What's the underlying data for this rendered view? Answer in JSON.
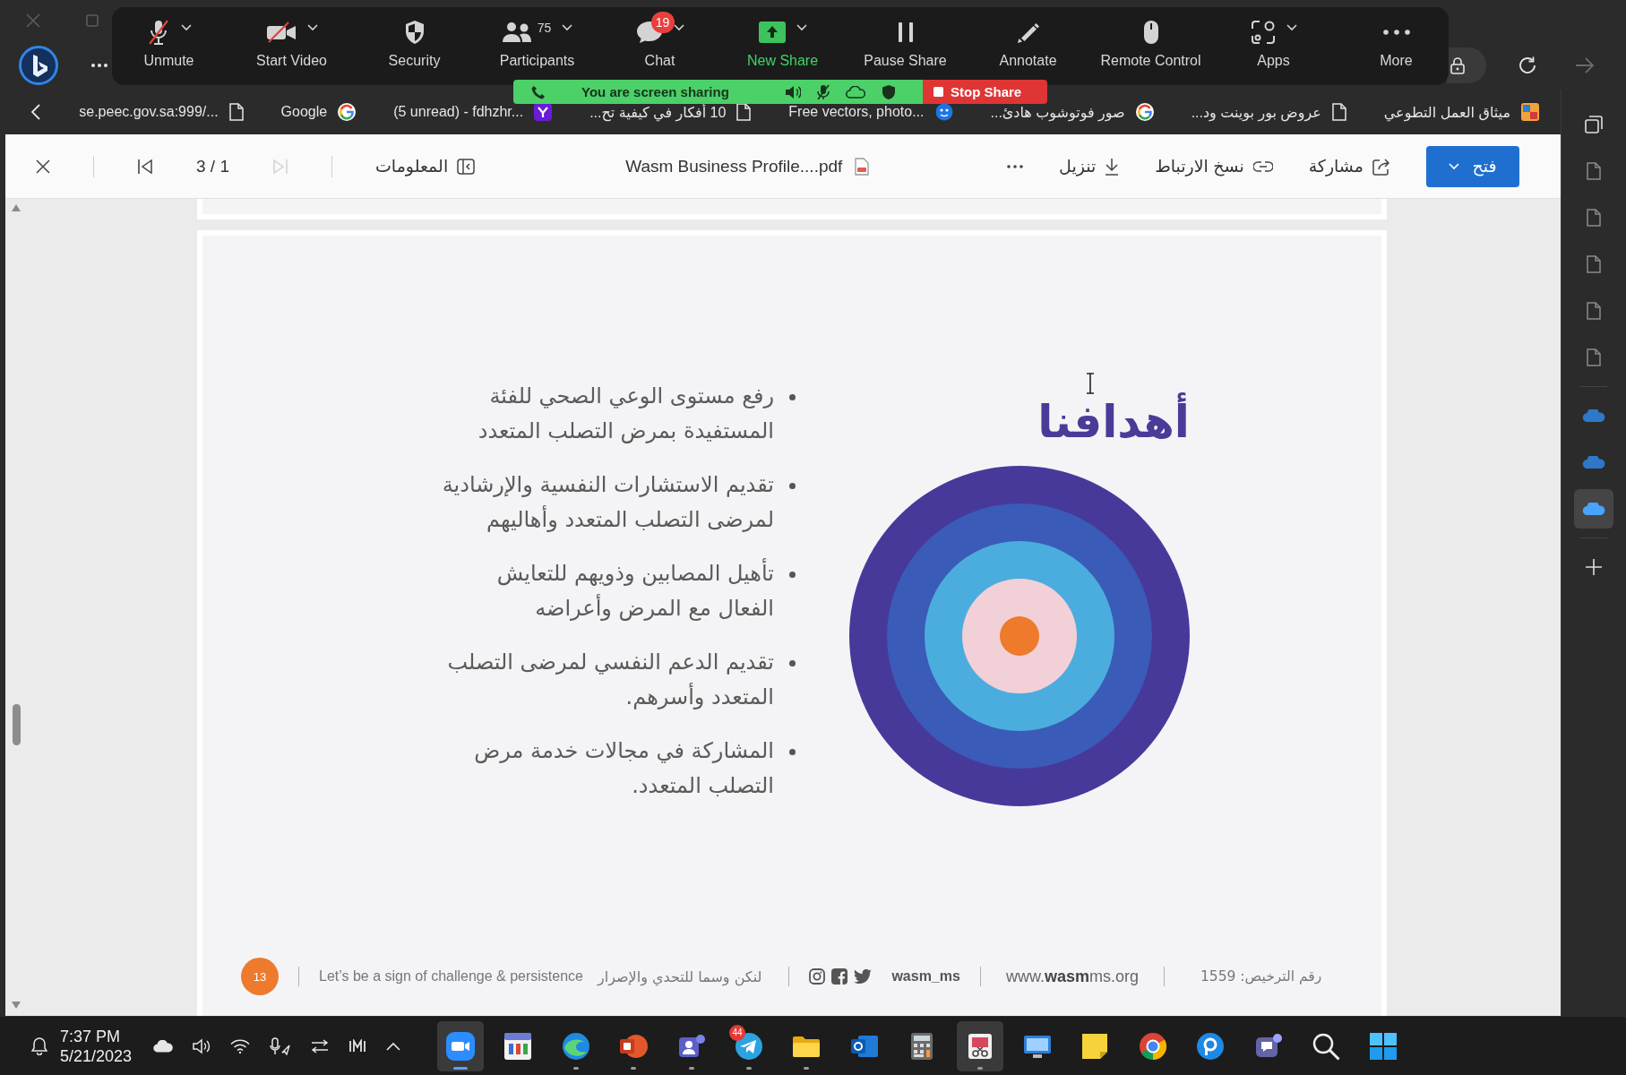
{
  "meeting_toolbar": {
    "buttons": [
      {
        "kind": "more",
        "label": "More",
        "caret": false
      },
      {
        "kind": "apps",
        "label": "Apps",
        "caret": true
      },
      {
        "kind": "remote-control",
        "label": "Remote Control",
        "caret": false
      },
      {
        "kind": "annotate",
        "label": "Annotate",
        "caret": false
      },
      {
        "kind": "pause-share",
        "label": "Pause Share",
        "caret": false
      },
      {
        "kind": "new-share",
        "label": "New Share",
        "caret": true
      },
      {
        "kind": "chat",
        "label": "Chat",
        "badge": "19",
        "caret": true
      },
      {
        "kind": "participants",
        "label": "Participants",
        "count": "75",
        "caret": true
      },
      {
        "kind": "security",
        "label": "Security",
        "caret": false
      },
      {
        "kind": "video-off",
        "label": "Start Video",
        "caret": true
      },
      {
        "kind": "mic-muted",
        "label": "Unmute",
        "caret": true
      }
    ]
  },
  "sharing_banner": {
    "status": "You are screen sharing",
    "stop_button": "Stop Share"
  },
  "browser": {
    "forward_disabled": true,
    "bookmarks": [
      {
        "label": "ميثاق العمل التطوعي",
        "kind": "site"
      },
      {
        "label": "عروض بور بوينت ود...",
        "kind": "page"
      },
      {
        "label": "صور فوتوشوب هادئ...",
        "kind": "google"
      },
      {
        "label": "Free vectors, photo...",
        "kind": "freepik"
      },
      {
        "label": "10 أفكار في كيفية تح...",
        "kind": "page"
      },
      {
        "label": "(5 unread) - fdhzhr...",
        "kind": "yahoo"
      },
      {
        "label": "Google",
        "kind": "google"
      },
      {
        "label": "se.peec.gov.sa:999/...",
        "kind": "page"
      }
    ]
  },
  "pdf_viewer": {
    "toolbar": {
      "page_indicator": "3 / 1",
      "next_disabled": true,
      "info_button": "المعلومات",
      "file_name": "Wasm Business Profile....pdf",
      "actions": [
        {
          "kind": "share",
          "label": "مشاركة"
        },
        {
          "kind": "link",
          "label": "نسخ الارتباط"
        },
        {
          "kind": "download",
          "label": "تنزيل"
        }
      ],
      "open_button": "فتح"
    },
    "page": {
      "title": "أهدافنا",
      "goals": [
        {
          "lines": [
            "رفع مستوى الوعي الصحي للفئة",
            "المستفيدة بمرض التصلب المتعدد"
          ]
        },
        {
          "lines": [
            "تقديم الاستشارات النفسية والإرشادية",
            "لمرضى التصلب المتعدد وأهاليهم"
          ]
        },
        {
          "lines": [
            "تأهيل المصابين وذويهم للتعايش",
            "الفعال مع المرض وأعراضه"
          ]
        },
        {
          "lines": [
            "تقديم الدعم النفسي لمرضى التصلب",
            "المتعدد وأسرهم."
          ]
        },
        {
          "lines": [
            "المشاركة في مجالات خدمة مرض",
            "التصلب المتعدد."
          ]
        }
      ],
      "footer": {
        "page_number": "13",
        "slogan_en": "Let’s be a sign of challenge & persistence",
        "slogan_ar": "لنكن وسما للتحدي والإصرار",
        "handle": "wasm_ms",
        "website": "www.**wasm**ms.org",
        "license": "رقم الترخيص: 1559"
      }
    }
  },
  "sidebar": {
    "items": [
      {
        "kind": "collections",
        "selected": false
      },
      {
        "kind": "page",
        "selected": false
      },
      {
        "kind": "page",
        "selected": false
      },
      {
        "kind": "page",
        "selected": false
      },
      {
        "kind": "page",
        "selected": false
      },
      {
        "kind": "page",
        "selected": false
      },
      {
        "kind": "cloud",
        "selected": false
      },
      {
        "kind": "cloud",
        "selected": false
      },
      {
        "kind": "cloud",
        "selected": true
      },
      {
        "kind": "add",
        "selected": false
      }
    ]
  },
  "taskbar": {
    "time": "7:37 PM",
    "date": "5/21/2023",
    "apps": [
      {
        "kind": "zoom",
        "running": true,
        "active": true,
        "highlighted": true
      },
      {
        "kind": "calendar",
        "running": false,
        "active": false,
        "highlighted": false
      },
      {
        "kind": "edge",
        "running": true,
        "active": false,
        "highlighted": false
      },
      {
        "kind": "powerpoint",
        "running": true,
        "active": false,
        "highlighted": false
      },
      {
        "kind": "teams",
        "running": true,
        "active": false,
        "highlighted": false
      },
      {
        "kind": "telegram",
        "running": true,
        "active": false,
        "highlighted": false,
        "badge": "44"
      },
      {
        "kind": "explorer",
        "running": true,
        "active": false,
        "highlighted": false
      },
      {
        "kind": "outlook",
        "running": false,
        "active": false,
        "highlighted": false
      },
      {
        "kind": "calculator",
        "running": false,
        "active": false,
        "highlighted": false
      },
      {
        "kind": "snipping",
        "running": true,
        "active": false,
        "highlighted": true
      },
      {
        "kind": "remote",
        "running": false,
        "active": false,
        "highlighted": false
      },
      {
        "kind": "sticky",
        "running": false,
        "active": false,
        "highlighted": false
      },
      {
        "kind": "chrome",
        "running": false,
        "active": false,
        "highlighted": false
      },
      {
        "kind": "pchat",
        "running": false,
        "active": false,
        "highlighted": false
      },
      {
        "kind": "teams-chat",
        "running": false,
        "active": false,
        "highlighted": false
      },
      {
        "kind": "search",
        "running": false,
        "active": false,
        "highlighted": false
      },
      {
        "kind": "start",
        "running": false,
        "active": false,
        "highlighted": false
      }
    ]
  }
}
